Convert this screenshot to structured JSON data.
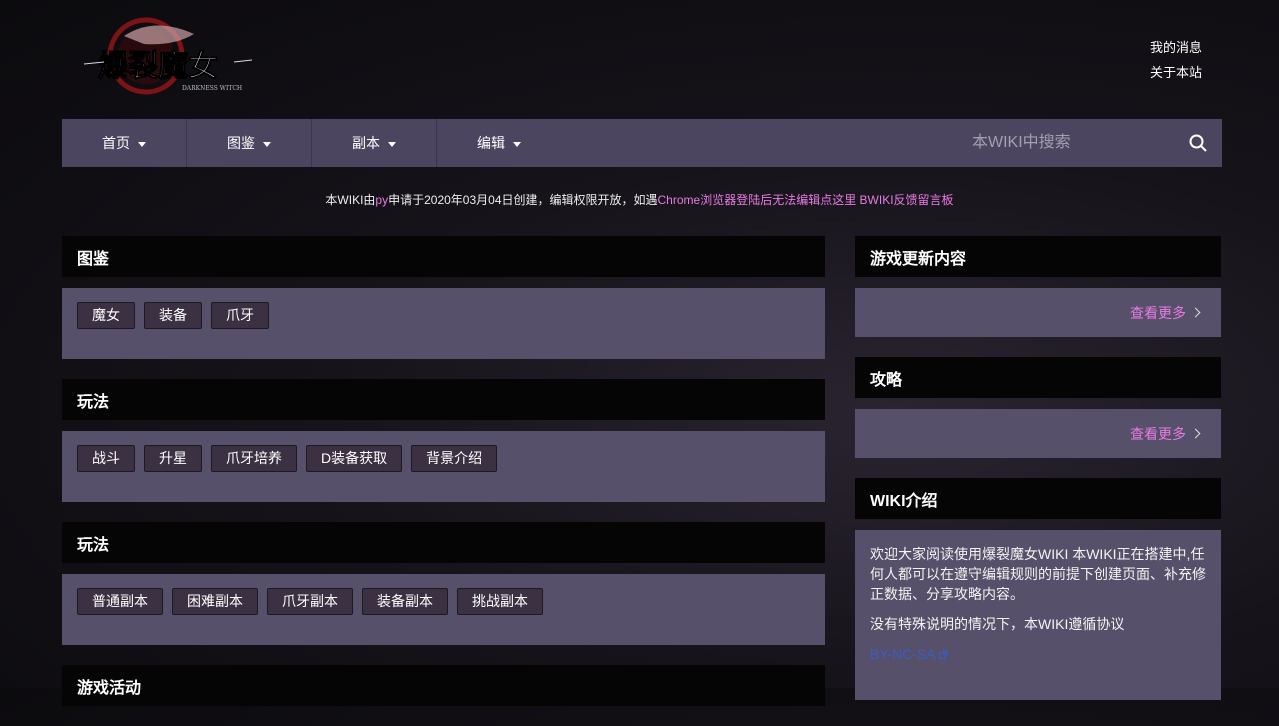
{
  "header": {
    "logo_text": "爆裂魔女",
    "logo_sub": "DARKNESS WITCH",
    "links": [
      "我的消息",
      "关于本站"
    ]
  },
  "nav": {
    "items": [
      "首页",
      "图鉴",
      "副本",
      "编辑"
    ],
    "search_placeholder": "本WIKI中搜索"
  },
  "notice": {
    "prefix": "本WIKI由",
    "user": "py",
    "middle": "申请于2020年03月04日创建，编辑权限开放，如遇",
    "chrome_link": "Chrome浏览器登陆后无法编辑点这里",
    "feedback_link": "BWIKI反馈留言板"
  },
  "left_sections": [
    {
      "title": "图鉴",
      "tags": [
        "魔女",
        "装备",
        "爪牙"
      ]
    },
    {
      "title": "玩法",
      "tags": [
        "战斗",
        "升星",
        "爪牙培养",
        "D装备获取",
        "背景介绍"
      ]
    },
    {
      "title": "玩法",
      "tags": [
        "普通副本",
        "困难副本",
        "爪牙副本",
        "装备副本",
        "挑战副本"
      ]
    },
    {
      "title": "游戏活动",
      "tags": []
    }
  ],
  "right_sections": {
    "updates": {
      "title": "游戏更新内容",
      "more": "查看更多"
    },
    "guides": {
      "title": "攻略",
      "more": "查看更多"
    },
    "intro": {
      "title": "WIKI介绍",
      "para1": "欢迎大家阅读使用爆裂魔女WIKI 本WIKI正在搭建中,任何人都可以在遵守编辑规则的前提下创建页面、补充修正数据、分享攻略内容。",
      "para2": "没有特殊说明的情况下，本WIKI遵循协议",
      "license": "BY-NC-SA"
    }
  },
  "colors": {
    "nav_bg": "#4b4560",
    "panel_bg": "#57506a",
    "accent_pink": "#e87be3",
    "header_bg": "#050506"
  }
}
